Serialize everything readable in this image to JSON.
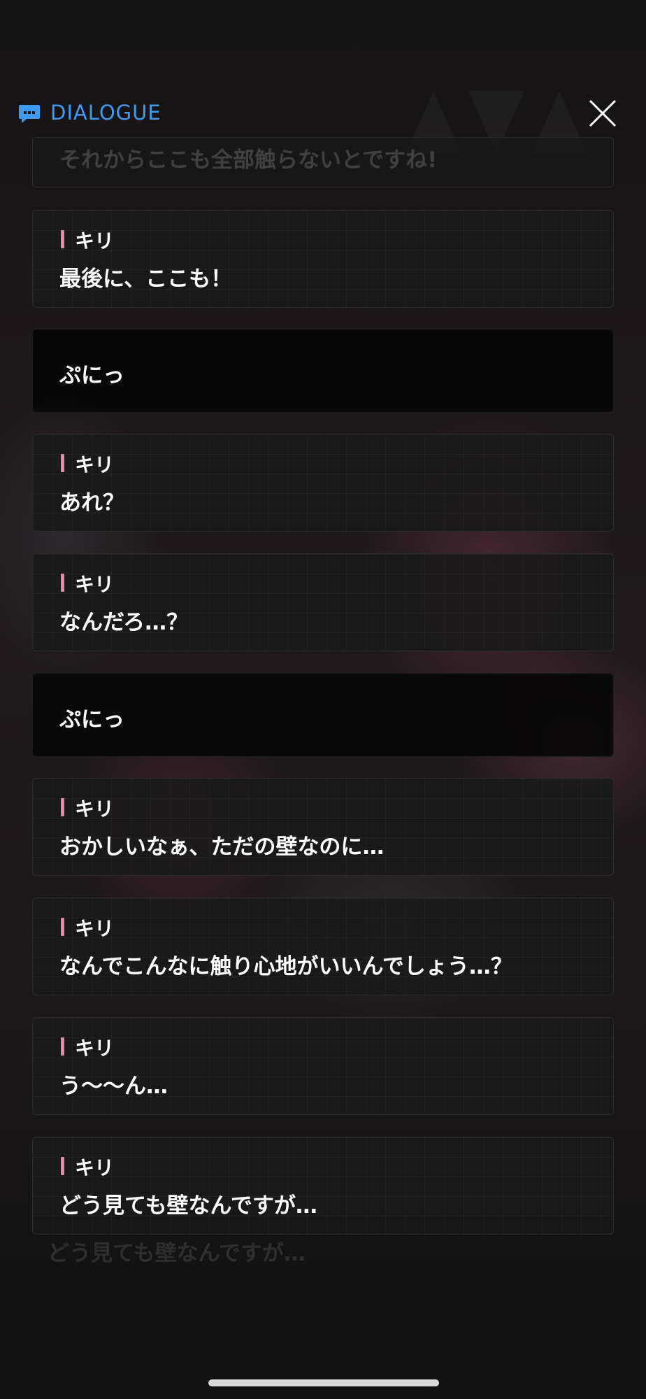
{
  "header": {
    "title": "DIALOGUE",
    "icon": "chat-bubble-icon",
    "close_icon": "close-icon"
  },
  "colors": {
    "accent": "#3e9bf0",
    "speaker_marker": "#e58aa6",
    "background": "#121212"
  },
  "partial_top_line": "それからここも全部触らないとですね!",
  "dialogue": [
    {
      "speaker": "キリ",
      "text": "最後に、ここも！"
    },
    {
      "speaker": "",
      "text": "ぷにっ"
    },
    {
      "speaker": "キリ",
      "text": "あれ？"
    },
    {
      "speaker": "キリ",
      "text": "なんだろ…？"
    },
    {
      "speaker": "",
      "text": "ぷにっ"
    },
    {
      "speaker": "キリ",
      "text": "おかしいなぁ、ただの壁なのに…"
    },
    {
      "speaker": "キリ",
      "text": "なんでこんなに触り心地がいいんでしょう…？"
    },
    {
      "speaker": "キリ",
      "text": "う～～ん…"
    },
    {
      "speaker": "キリ",
      "text": "どう見ても壁なんですが…"
    }
  ],
  "background_caption": "どう見ても壁なんですが…"
}
